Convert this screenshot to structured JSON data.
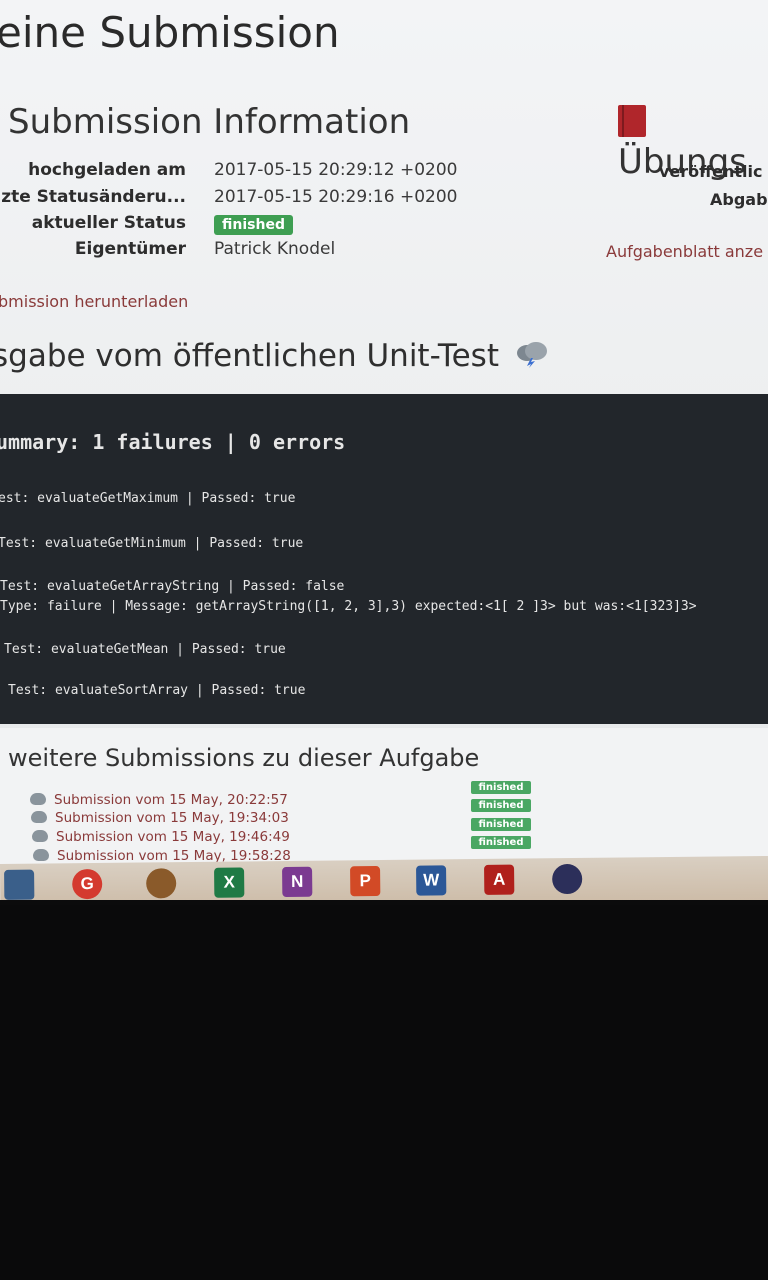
{
  "page": {
    "title": "eine Submission"
  },
  "submission_info": {
    "title": "Submission Information",
    "rows": [
      {
        "label": "hochgeladen am",
        "value": "2017-05-15 20:29:12 +0200"
      },
      {
        "label": "zte Statusänderu...",
        "value": "2017-05-15 20:29:16 +0200"
      },
      {
        "label": "aktueller Status",
        "value": "finished"
      },
      {
        "label": "Eigentümer",
        "value": "Patrick Knodel"
      }
    ],
    "download_link": "bmission herunterladen"
  },
  "exercise_panel": {
    "title": "Übungs",
    "published_label": "veröffentlic",
    "deadline_label": "Abgab",
    "sheet_link": "Aufgabenblatt anze"
  },
  "unit_test": {
    "title": "sgabe vom öffentlichen Unit-Test",
    "summary": "ummary: 1 failures | 0 errors",
    "lines": [
      "est: evaluateGetMaximum | Passed: true",
      "Test: evaluateGetMinimum | Passed: true",
      "Test: evaluateGetArrayString | Passed: false",
      "Type: failure | Message: getArrayString([1, 2, 3],3) expected:<1[ 2 ]3> but was:<1[323]3>",
      "Test: evaluateGetMean | Passed: true",
      "Test: evaluateSortArray | Passed: true"
    ]
  },
  "more_submissions": {
    "title": "weitere Submissions zu dieser Aufgabe",
    "items": [
      {
        "label": "Submission vom 15 May, 20:22:57",
        "status": "finished"
      },
      {
        "label": "Submission vom 15 May, 19:34:03",
        "status": "finished"
      },
      {
        "label": "Submission vom 15 May, 19:46:49",
        "status": "finished"
      },
      {
        "label": "Submission vom 15 May, 19:58:28",
        "status": "finished"
      }
    ]
  },
  "taskbar": {
    "icons": [
      {
        "name": "desktop-icon",
        "glyph": ""
      },
      {
        "name": "browser-icon",
        "glyph": "G"
      },
      {
        "name": "media-player-icon",
        "glyph": ""
      },
      {
        "name": "excel-icon",
        "glyph": "X"
      },
      {
        "name": "onenote-icon",
        "glyph": "N"
      },
      {
        "name": "powerpoint-icon",
        "glyph": "P"
      },
      {
        "name": "word-icon",
        "glyph": "W"
      },
      {
        "name": "acrobat-icon",
        "glyph": "A"
      },
      {
        "name": "eclipse-icon",
        "glyph": ""
      }
    ]
  },
  "colors": {
    "status_green": "#3e9e52",
    "link_red": "#8a3a3a",
    "console_bg": "#22262b"
  }
}
